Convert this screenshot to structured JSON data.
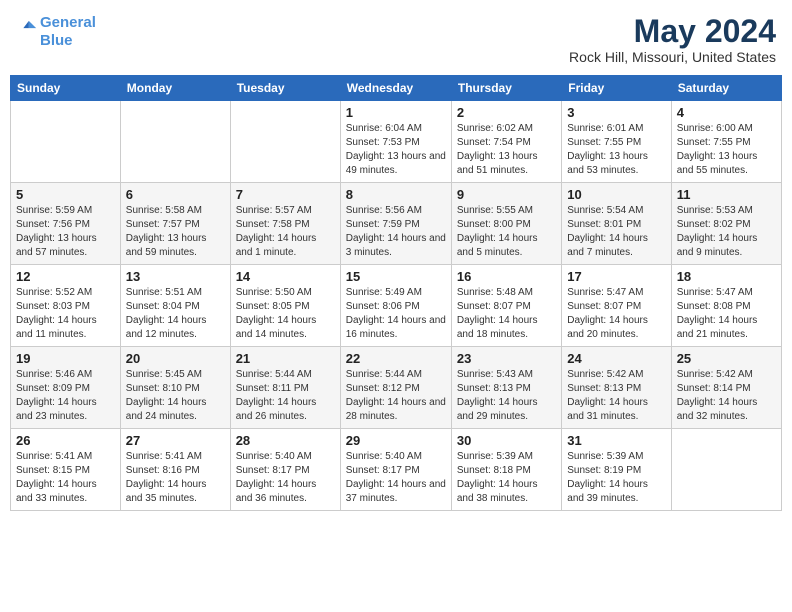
{
  "header": {
    "logo_line1": "General",
    "logo_line2": "Blue",
    "month": "May 2024",
    "location": "Rock Hill, Missouri, United States"
  },
  "weekdays": [
    "Sunday",
    "Monday",
    "Tuesday",
    "Wednesday",
    "Thursday",
    "Friday",
    "Saturday"
  ],
  "weeks": [
    [
      {
        "day": "",
        "sunrise": "",
        "sunset": "",
        "daylight": ""
      },
      {
        "day": "",
        "sunrise": "",
        "sunset": "",
        "daylight": ""
      },
      {
        "day": "",
        "sunrise": "",
        "sunset": "",
        "daylight": ""
      },
      {
        "day": "1",
        "sunrise": "Sunrise: 6:04 AM",
        "sunset": "Sunset: 7:53 PM",
        "daylight": "Daylight: 13 hours and 49 minutes."
      },
      {
        "day": "2",
        "sunrise": "Sunrise: 6:02 AM",
        "sunset": "Sunset: 7:54 PM",
        "daylight": "Daylight: 13 hours and 51 minutes."
      },
      {
        "day": "3",
        "sunrise": "Sunrise: 6:01 AM",
        "sunset": "Sunset: 7:55 PM",
        "daylight": "Daylight: 13 hours and 53 minutes."
      },
      {
        "day": "4",
        "sunrise": "Sunrise: 6:00 AM",
        "sunset": "Sunset: 7:55 PM",
        "daylight": "Daylight: 13 hours and 55 minutes."
      }
    ],
    [
      {
        "day": "5",
        "sunrise": "Sunrise: 5:59 AM",
        "sunset": "Sunset: 7:56 PM",
        "daylight": "Daylight: 13 hours and 57 minutes."
      },
      {
        "day": "6",
        "sunrise": "Sunrise: 5:58 AM",
        "sunset": "Sunset: 7:57 PM",
        "daylight": "Daylight: 13 hours and 59 minutes."
      },
      {
        "day": "7",
        "sunrise": "Sunrise: 5:57 AM",
        "sunset": "Sunset: 7:58 PM",
        "daylight": "Daylight: 14 hours and 1 minute."
      },
      {
        "day": "8",
        "sunrise": "Sunrise: 5:56 AM",
        "sunset": "Sunset: 7:59 PM",
        "daylight": "Daylight: 14 hours and 3 minutes."
      },
      {
        "day": "9",
        "sunrise": "Sunrise: 5:55 AM",
        "sunset": "Sunset: 8:00 PM",
        "daylight": "Daylight: 14 hours and 5 minutes."
      },
      {
        "day": "10",
        "sunrise": "Sunrise: 5:54 AM",
        "sunset": "Sunset: 8:01 PM",
        "daylight": "Daylight: 14 hours and 7 minutes."
      },
      {
        "day": "11",
        "sunrise": "Sunrise: 5:53 AM",
        "sunset": "Sunset: 8:02 PM",
        "daylight": "Daylight: 14 hours and 9 minutes."
      }
    ],
    [
      {
        "day": "12",
        "sunrise": "Sunrise: 5:52 AM",
        "sunset": "Sunset: 8:03 PM",
        "daylight": "Daylight: 14 hours and 11 minutes."
      },
      {
        "day": "13",
        "sunrise": "Sunrise: 5:51 AM",
        "sunset": "Sunset: 8:04 PM",
        "daylight": "Daylight: 14 hours and 12 minutes."
      },
      {
        "day": "14",
        "sunrise": "Sunrise: 5:50 AM",
        "sunset": "Sunset: 8:05 PM",
        "daylight": "Daylight: 14 hours and 14 minutes."
      },
      {
        "day": "15",
        "sunrise": "Sunrise: 5:49 AM",
        "sunset": "Sunset: 8:06 PM",
        "daylight": "Daylight: 14 hours and 16 minutes."
      },
      {
        "day": "16",
        "sunrise": "Sunrise: 5:48 AM",
        "sunset": "Sunset: 8:07 PM",
        "daylight": "Daylight: 14 hours and 18 minutes."
      },
      {
        "day": "17",
        "sunrise": "Sunrise: 5:47 AM",
        "sunset": "Sunset: 8:07 PM",
        "daylight": "Daylight: 14 hours and 20 minutes."
      },
      {
        "day": "18",
        "sunrise": "Sunrise: 5:47 AM",
        "sunset": "Sunset: 8:08 PM",
        "daylight": "Daylight: 14 hours and 21 minutes."
      }
    ],
    [
      {
        "day": "19",
        "sunrise": "Sunrise: 5:46 AM",
        "sunset": "Sunset: 8:09 PM",
        "daylight": "Daylight: 14 hours and 23 minutes."
      },
      {
        "day": "20",
        "sunrise": "Sunrise: 5:45 AM",
        "sunset": "Sunset: 8:10 PM",
        "daylight": "Daylight: 14 hours and 24 minutes."
      },
      {
        "day": "21",
        "sunrise": "Sunrise: 5:44 AM",
        "sunset": "Sunset: 8:11 PM",
        "daylight": "Daylight: 14 hours and 26 minutes."
      },
      {
        "day": "22",
        "sunrise": "Sunrise: 5:44 AM",
        "sunset": "Sunset: 8:12 PM",
        "daylight": "Daylight: 14 hours and 28 minutes."
      },
      {
        "day": "23",
        "sunrise": "Sunrise: 5:43 AM",
        "sunset": "Sunset: 8:13 PM",
        "daylight": "Daylight: 14 hours and 29 minutes."
      },
      {
        "day": "24",
        "sunrise": "Sunrise: 5:42 AM",
        "sunset": "Sunset: 8:13 PM",
        "daylight": "Daylight: 14 hours and 31 minutes."
      },
      {
        "day": "25",
        "sunrise": "Sunrise: 5:42 AM",
        "sunset": "Sunset: 8:14 PM",
        "daylight": "Daylight: 14 hours and 32 minutes."
      }
    ],
    [
      {
        "day": "26",
        "sunrise": "Sunrise: 5:41 AM",
        "sunset": "Sunset: 8:15 PM",
        "daylight": "Daylight: 14 hours and 33 minutes."
      },
      {
        "day": "27",
        "sunrise": "Sunrise: 5:41 AM",
        "sunset": "Sunset: 8:16 PM",
        "daylight": "Daylight: 14 hours and 35 minutes."
      },
      {
        "day": "28",
        "sunrise": "Sunrise: 5:40 AM",
        "sunset": "Sunset: 8:17 PM",
        "daylight": "Daylight: 14 hours and 36 minutes."
      },
      {
        "day": "29",
        "sunrise": "Sunrise: 5:40 AM",
        "sunset": "Sunset: 8:17 PM",
        "daylight": "Daylight: 14 hours and 37 minutes."
      },
      {
        "day": "30",
        "sunrise": "Sunrise: 5:39 AM",
        "sunset": "Sunset: 8:18 PM",
        "daylight": "Daylight: 14 hours and 38 minutes."
      },
      {
        "day": "31",
        "sunrise": "Sunrise: 5:39 AM",
        "sunset": "Sunset: 8:19 PM",
        "daylight": "Daylight: 14 hours and 39 minutes."
      },
      {
        "day": "",
        "sunrise": "",
        "sunset": "",
        "daylight": ""
      }
    ]
  ]
}
